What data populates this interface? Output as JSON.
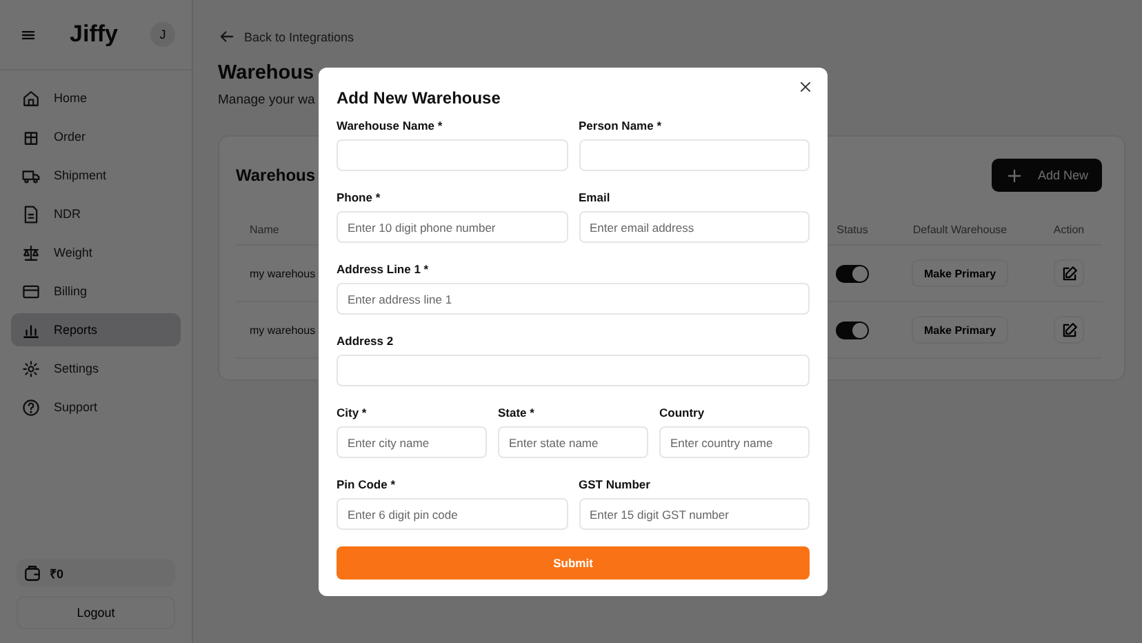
{
  "sidebar": {
    "brand": "Jiffy",
    "avatar": "J",
    "items": [
      {
        "label": "Home",
        "selected": false
      },
      {
        "label": "Order",
        "selected": false
      },
      {
        "label": "Shipment",
        "selected": false
      },
      {
        "label": "NDR",
        "selected": false
      },
      {
        "label": "Weight",
        "selected": false
      },
      {
        "label": "Billing",
        "selected": false
      },
      {
        "label": "Reports",
        "selected": true
      },
      {
        "label": "Settings",
        "selected": false
      },
      {
        "label": "Support",
        "selected": false
      }
    ],
    "wallet": "₹0",
    "logout": "Logout"
  },
  "main": {
    "back_link": "Back to Integrations",
    "title": "Warehous",
    "subtitle": "Manage your wa",
    "card": {
      "title": "Warehous",
      "add_button": "Add New",
      "columns": [
        "Name",
        "Status",
        "Default Warehouse",
        "Action"
      ],
      "rows": [
        {
          "name": "my warehous",
          "on": true,
          "default_button": "Make Primary"
        },
        {
          "name": "my warehous",
          "on": true,
          "default_button": "Make Primary"
        }
      ]
    }
  },
  "modal": {
    "title": "Add New Warehouse",
    "rows": [
      [
        {
          "label": "Warehouse Name *"
        },
        {
          "label": "Person Name *"
        }
      ],
      [
        {
          "label": "Phone *",
          "placeholder": "Enter 10 digit phone number"
        },
        {
          "label": "Email",
          "placeholder": "Enter email address"
        }
      ],
      [
        {
          "label": "Address Line 1 *",
          "placeholder": "Enter address line 1"
        }
      ],
      [
        {
          "label": "Address 2"
        }
      ],
      [
        {
          "label": "City *",
          "placeholder": "Enter city name"
        },
        {
          "label": "State *",
          "placeholder": "Enter state name"
        },
        {
          "label": "Country",
          "placeholder": "Enter country name"
        }
      ],
      [
        {
          "label": "Pin Code *",
          "placeholder": "Enter 6 digit pin code"
        },
        {
          "label": "GST Number",
          "placeholder": "Enter 15 digit GST number"
        }
      ]
    ],
    "submit": "Submit"
  }
}
